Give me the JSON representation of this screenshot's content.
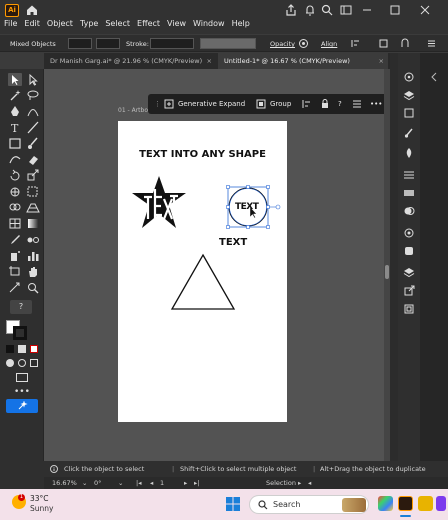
{
  "app": {
    "logo_text": "Ai",
    "menu": [
      "File",
      "Edit",
      "Object",
      "Type",
      "Select",
      "Effect",
      "View",
      "Window",
      "Help"
    ]
  },
  "controlbar": {
    "selection_label": "Mixed Objects",
    "stroke_label": "Stroke:",
    "opacity_label": "Opacity",
    "align_label": "Align"
  },
  "tabs": [
    {
      "label": "Dr Manish Garg.ai* @ 21.96 % (CMYK/Preview)",
      "active": false
    },
    {
      "label": "Untitled-1* @ 16.67 % (CMYK/Preview)",
      "active": true
    }
  ],
  "canvas": {
    "artboard_label": "01 - Artbo...",
    "context_bar": {
      "generative_expand": "Generative Expand",
      "group": "Group"
    },
    "art_title": "TEXT INTO ANY SHAPE",
    "circle_text": "TEXT",
    "plain_text": "TEXT"
  },
  "hint": {
    "text1": "Click the object to select",
    "text2": "Shift+Click to select multiple object",
    "text3": "Alt+Drag the object to duplicate"
  },
  "status": {
    "zoom": "16.67%",
    "rotation": "0°",
    "artboard_number": "1",
    "mode": "Selection"
  },
  "taskbar": {
    "weather_badge": "1",
    "temperature": "33°C",
    "condition": "Sunny",
    "search_label": "Search"
  },
  "colors": {
    "accent_orange": "#ff9a00",
    "selection_blue": "#2e6bd6",
    "taskbar_bg": "#f3e1ea"
  }
}
